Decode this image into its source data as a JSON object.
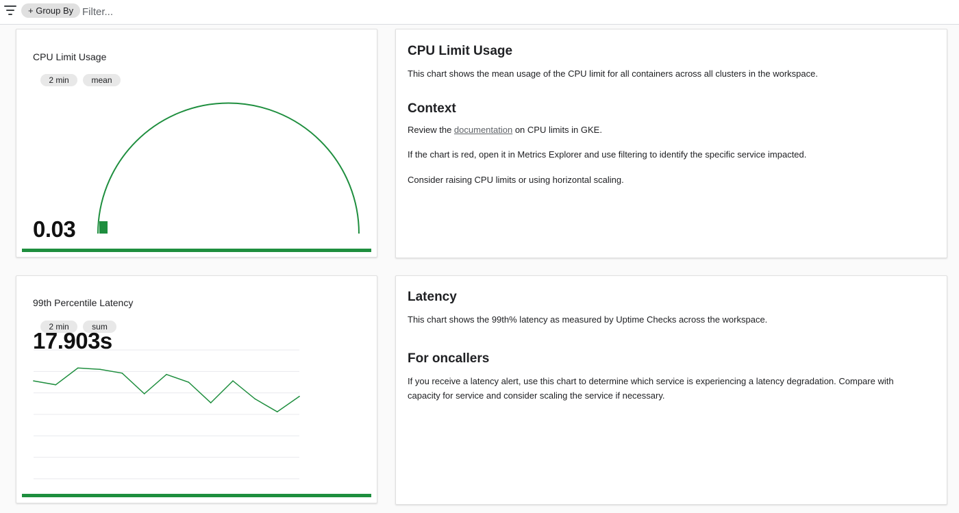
{
  "toolbar": {
    "group_by_label": "+ Group By",
    "filter_placeholder": "Filter..."
  },
  "cpu_chart": {
    "title": "CPU Limit Usage",
    "chips": [
      "2 min",
      "mean"
    ],
    "value_text": "0.03",
    "gauge_fraction": 0.03,
    "status_color": "#1e8e3e"
  },
  "cpu_doc": {
    "heading": "CPU Limit Usage",
    "description": "This chart shows the mean usage of the CPU limit for all containers across all clusters in the workspace.",
    "context_heading": "Context",
    "context_prefix": "Review the ",
    "context_link": "documentation",
    "context_suffix": " on CPU limits in GKE.",
    "context_p2": "If the chart is red, open it in Metrics Explorer and use filtering to identify the specific service impacted.",
    "context_p3": "Consider raising CPU limits or using horizontal scaling."
  },
  "latency_chart": {
    "title": "99th Percentile Latency",
    "chips": [
      "2 min",
      "sum"
    ],
    "value_text": "17.903s",
    "status_color": "#1e8e3e"
  },
  "latency_doc": {
    "heading": "Latency",
    "description": "This chart shows the 99th% latency as measured by Uptime Checks across the workspace.",
    "oncall_heading": "For oncallers",
    "oncall_text": "If you receive a latency alert, use this chart to determine which service is experiencing a latency degradation. Compare with capacity for service and consider scaling the service if necessary."
  },
  "chart_data": {
    "type": "line",
    "series": [
      {
        "values": [
          17.6,
          17.3,
          18.6,
          18.5,
          18.2,
          16.6,
          18.1,
          17.5,
          15.9,
          17.6,
          16.2,
          15.2,
          16.4
        ]
      }
    ],
    "ylim": [
      10,
      20
    ],
    "grid": true,
    "line_color": "#1e8e3e"
  }
}
